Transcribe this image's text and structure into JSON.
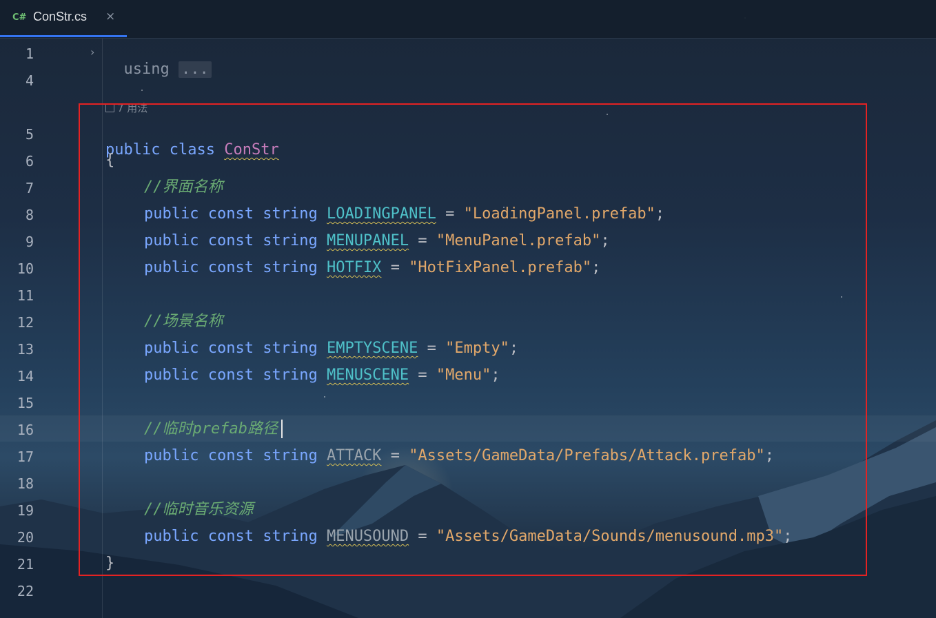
{
  "tab": {
    "lang": "C#",
    "title": "ConStr.cs",
    "close": "×"
  },
  "fold": {
    "keyword": "using",
    "ellipsis": "..."
  },
  "hint": {
    "text": "7 用法"
  },
  "line_numbers": [
    "1",
    "4",
    "5",
    "6",
    "7",
    "8",
    "9",
    "10",
    "11",
    "12",
    "13",
    "14",
    "15",
    "16",
    "17",
    "18",
    "19",
    "20",
    "21",
    "22"
  ],
  "code": {
    "l5": {
      "kw1": "public",
      "kw2": "class",
      "name": "ConStr"
    },
    "l6": {
      "brace": "{"
    },
    "l7": {
      "comment": "//界面名称"
    },
    "l8": {
      "kw1": "public",
      "kw2": "const",
      "kw3": "string",
      "name": "LOADINGPANEL",
      "eq": "=",
      "value": "\"LoadingPanel.prefab\"",
      "semi": ";"
    },
    "l9": {
      "kw1": "public",
      "kw2": "const",
      "kw3": "string",
      "name": "MENUPANEL",
      "eq": "=",
      "value": "\"MenuPanel.prefab\"",
      "semi": ";"
    },
    "l10": {
      "kw1": "public",
      "kw2": "const",
      "kw3": "string",
      "name": "HOTFIX",
      "eq": "=",
      "value": "\"HotFixPanel.prefab\"",
      "semi": ";"
    },
    "l12": {
      "comment": "//场景名称"
    },
    "l13": {
      "kw1": "public",
      "kw2": "const",
      "kw3": "string",
      "name": "EMPTYSCENE",
      "eq": "=",
      "value": "\"Empty\"",
      "semi": ";"
    },
    "l14": {
      "kw1": "public",
      "kw2": "const",
      "kw3": "string",
      "name": "MENUSCENE",
      "eq": "=",
      "value": "\"Menu\"",
      "semi": ";"
    },
    "l16": {
      "comment": "//临时prefab路径"
    },
    "l17": {
      "kw1": "public",
      "kw2": "const",
      "kw3": "string",
      "name": "ATTACK",
      "eq": "=",
      "value": "\"Assets/GameData/Prefabs/Attack.prefab\"",
      "semi": ";"
    },
    "l19": {
      "comment": "//临时音乐资源"
    },
    "l20": {
      "kw1": "public",
      "kw2": "const",
      "kw3": "string",
      "name": "MENUSOUND",
      "eq": "=",
      "value": "\"Assets/GameData/Sounds/menusound.mp3\"",
      "semi": ";"
    },
    "l21": {
      "brace": "}"
    }
  },
  "colors": {
    "keyword": "#7aa7ff",
    "class_name": "#c77dbb",
    "constant": "#4fc1c9",
    "string": "#e2a86a",
    "comment": "#6aab73",
    "highlight_border": "#e52222",
    "tab_underline": "#3574f0"
  }
}
